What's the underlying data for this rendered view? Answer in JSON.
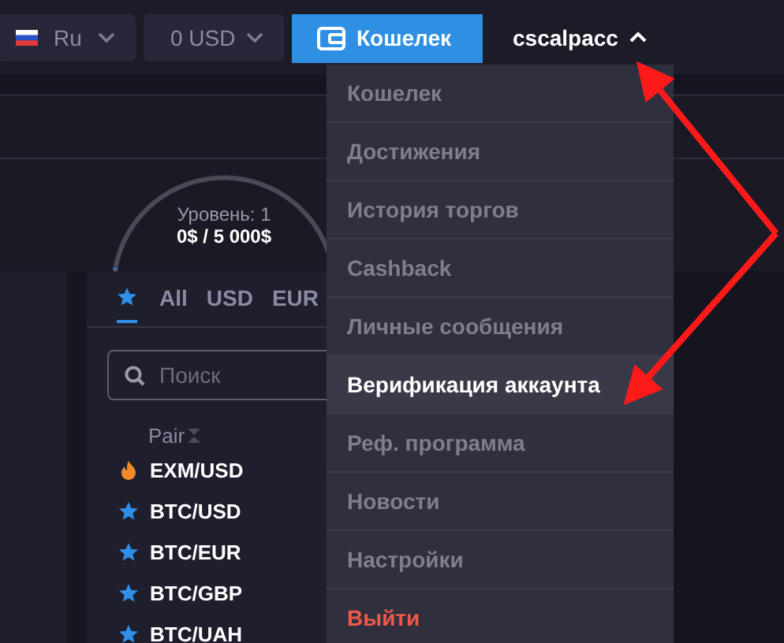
{
  "header": {
    "language": {
      "label": "Ru"
    },
    "currency": {
      "label": "0 USD"
    },
    "wallet_button": {
      "label": "Кошелек"
    },
    "user": {
      "name": "cscalpacc",
      "expanded": true
    }
  },
  "level": {
    "label": "Уровень: 1",
    "progress": "0$ / 5 000$",
    "level": 0
  },
  "pairs_panel": {
    "tabs": [
      {
        "kind": "favorites",
        "selected": true
      },
      {
        "kind": "text",
        "label": "All",
        "selected": false
      },
      {
        "kind": "text",
        "label": "USD",
        "selected": false
      },
      {
        "kind": "text",
        "label": "EUR",
        "selected": false
      }
    ],
    "search": {
      "placeholder": "Поиск"
    },
    "columns": [
      "Pair"
    ],
    "rows": [
      {
        "kind": "hot",
        "pair": "EXM/USD"
      },
      {
        "kind": "favorite",
        "pair": "BTC/USD"
      },
      {
        "kind": "favorite",
        "pair": "BTC/EUR"
      },
      {
        "kind": "favorite",
        "pair": "BTC/GBP"
      },
      {
        "kind": "favorite",
        "pair": "BTC/UAH"
      }
    ]
  },
  "user_menu": {
    "items": [
      {
        "label": "Кошелек",
        "kind": "normal",
        "selected": false
      },
      {
        "label": "Достижения",
        "kind": "normal",
        "selected": false
      },
      {
        "label": "История торгов",
        "kind": "normal",
        "selected": false
      },
      {
        "label": "Cashback",
        "kind": "normal",
        "selected": false
      },
      {
        "label": "Личные сообщения",
        "kind": "normal",
        "selected": false
      },
      {
        "label": "Верификация аккаунта",
        "kind": "normal",
        "selected": true
      },
      {
        "label": "Реф. программа",
        "kind": "normal",
        "selected": false
      },
      {
        "label": "Новости",
        "kind": "normal",
        "selected": false
      },
      {
        "label": "Настройки",
        "kind": "normal",
        "selected": false
      },
      {
        "label": "Выйти",
        "kind": "logout",
        "selected": false
      }
    ]
  }
}
